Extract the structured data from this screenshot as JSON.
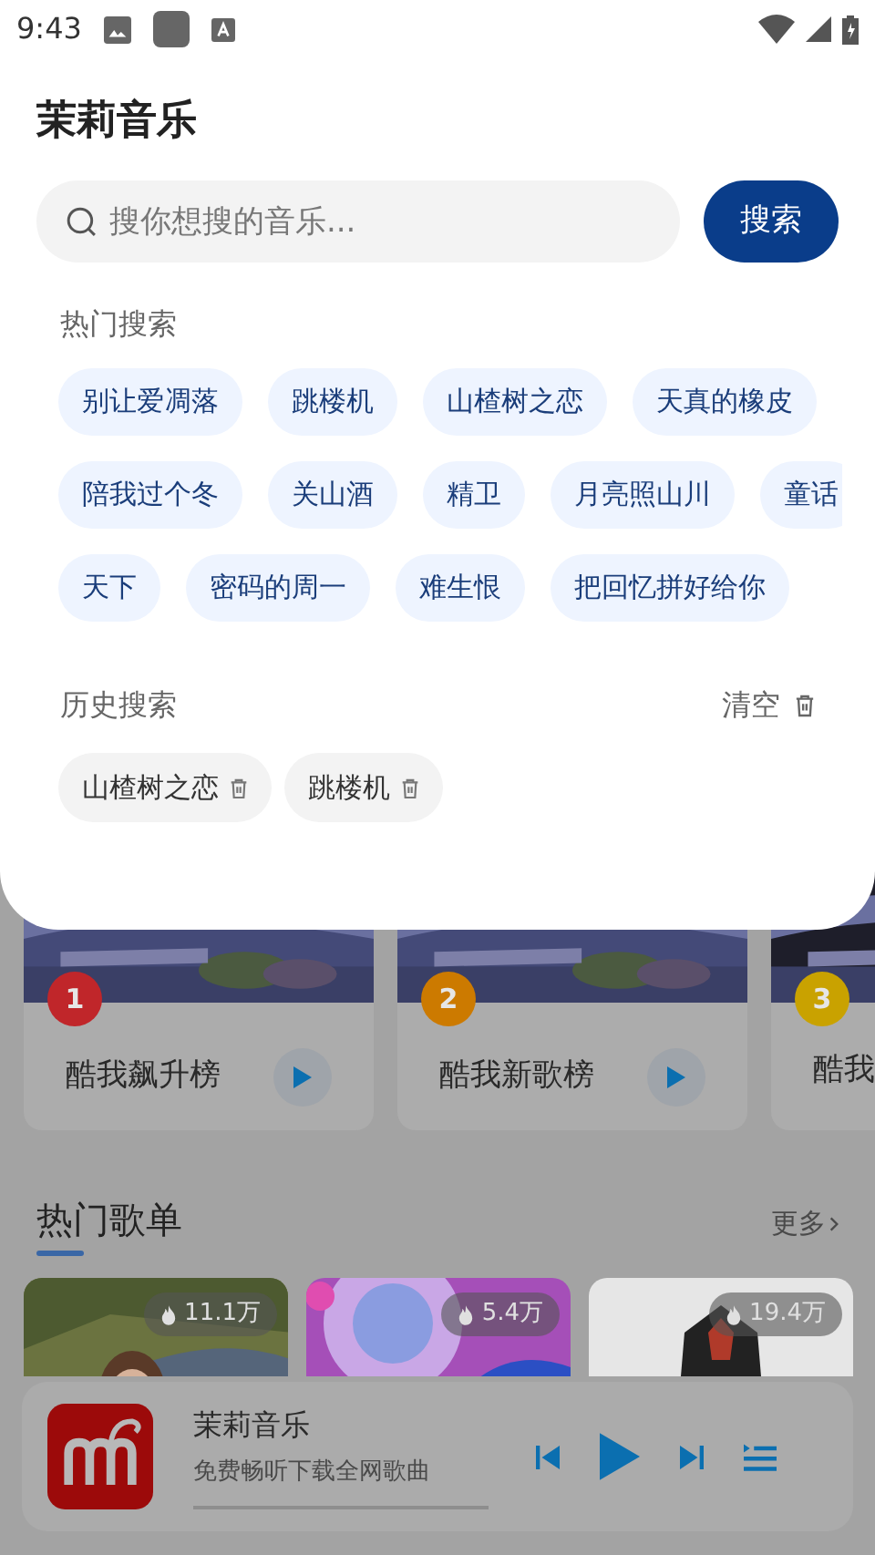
{
  "status_bar": {
    "time": "9:43"
  },
  "app_title": "茉莉音乐",
  "search": {
    "placeholder": "搜你想搜的音乐...",
    "button": "搜索"
  },
  "hot_search": {
    "title": "热门搜索",
    "rows": [
      [
        {
          "label": "别让爱凋落"
        },
        {
          "label": "跳楼机"
        },
        {
          "label": "山楂树之恋"
        },
        {
          "label": "天真的橡皮"
        }
      ],
      [
        {
          "label": "陪我过个冬"
        },
        {
          "label": "关山酒"
        },
        {
          "label": "精卫"
        },
        {
          "label": "月亮照山川"
        },
        {
          "label": "童话"
        }
      ],
      [
        {
          "label": "天下"
        },
        {
          "label": "密码的周一"
        },
        {
          "label": "难生恨"
        },
        {
          "label": "把回忆拼好给你"
        }
      ]
    ]
  },
  "history": {
    "title": "历史搜索",
    "clear": "清空",
    "items": [
      {
        "label": "山楂树之恋"
      },
      {
        "label": "跳楼机"
      }
    ]
  },
  "charts": [
    {
      "rank": "1",
      "title": "酷我飙升榜",
      "color": "#c0262a"
    },
    {
      "rank": "2",
      "title": "酷我新歌榜",
      "color": "#cc7a00"
    },
    {
      "rank": "3",
      "title": "酷我",
      "color": "#c9a200"
    }
  ],
  "playlists": {
    "title": "热门歌单",
    "more": "更多",
    "items": [
      {
        "plays": "11.1万"
      },
      {
        "plays": "5.4万"
      },
      {
        "plays": "19.4万"
      }
    ]
  },
  "player": {
    "title": "茉莉音乐",
    "subtitle": "免费畅听下载全网歌曲"
  }
}
